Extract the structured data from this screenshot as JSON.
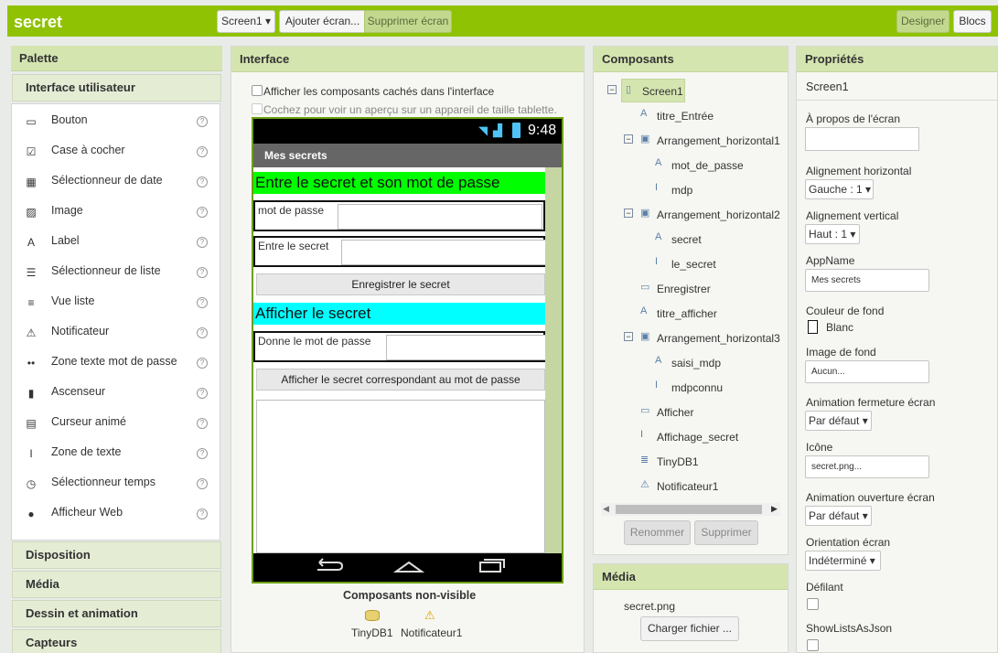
{
  "app": {
    "name": "secret"
  },
  "topbar": {
    "screen_select": "Screen1 ▾",
    "add_screen": "Ajouter écran...",
    "remove_screen": "Supprimer écran",
    "designer": "Designer",
    "blocks": "Blocs"
  },
  "palette": {
    "title": "Palette",
    "category_active": "Interface utilisateur",
    "items": [
      {
        "label": "Bouton",
        "icon": "button-icon"
      },
      {
        "label": "Case à cocher",
        "icon": "checkbox-icon"
      },
      {
        "label": "Sélectionneur de date",
        "icon": "date-picker-icon"
      },
      {
        "label": "Image",
        "icon": "image-icon"
      },
      {
        "label": "Label",
        "icon": "label-icon"
      },
      {
        "label": "Sélectionneur de liste",
        "icon": "list-picker-icon"
      },
      {
        "label": "Vue liste",
        "icon": "list-view-icon"
      },
      {
        "label": "Notificateur",
        "icon": "notifier-icon"
      },
      {
        "label": "Zone texte mot de passe",
        "icon": "password-icon"
      },
      {
        "label": "Ascenseur",
        "icon": "slider-icon"
      },
      {
        "label": "Curseur animé",
        "icon": "spinner-icon"
      },
      {
        "label": "Zone de texte",
        "icon": "textbox-icon"
      },
      {
        "label": "Sélectionneur temps",
        "icon": "time-picker-icon"
      },
      {
        "label": "Afficheur Web",
        "icon": "web-viewer-icon"
      }
    ],
    "help": "?",
    "categories": [
      "Disposition",
      "Média",
      "Dessin et animation",
      "Capteurs"
    ]
  },
  "viewer": {
    "title": "Interface",
    "show_hidden": "Afficher les composants cachés dans l'interface",
    "tablet_preview": "Cochez pour voir un aperçu sur un appareil de taille tablette.",
    "time": "9:48",
    "screen_title": "Mes secrets",
    "label1": "Entre le secret et son mot de passe",
    "row1_label": "mot de passe",
    "row2_label": "Entre le secret",
    "save_button": "Enregistrer le secret",
    "label2": "Afficher le secret",
    "row3_label": "Donne le mot de passe",
    "show_button": "Afficher le secret correspondant au mot de passe",
    "nonvisible_title": "Composants non-visible",
    "nonvisible": [
      "TinyDB1",
      "Notificateur1"
    ]
  },
  "components": {
    "title": "Composants",
    "tree": [
      {
        "label": "Screen1",
        "level": 0,
        "toggle": "−",
        "icon": "screen-icon",
        "selected": true
      },
      {
        "label": "titre_Entrée",
        "level": 1,
        "icon": "label-icon"
      },
      {
        "label": "Arrangement_horizontal1",
        "level": 1,
        "toggle": "−",
        "icon": "arrangement-icon"
      },
      {
        "label": "mot_de_passe",
        "level": 2,
        "icon": "label-icon"
      },
      {
        "label": "mdp",
        "level": 2,
        "icon": "textbox-icon"
      },
      {
        "label": "Arrangement_horizontal2",
        "level": 1,
        "toggle": "−",
        "icon": "arrangement-icon"
      },
      {
        "label": "secret",
        "level": 2,
        "icon": "label-icon"
      },
      {
        "label": "le_secret",
        "level": 2,
        "icon": "textbox-icon"
      },
      {
        "label": "Enregistrer",
        "level": 1,
        "icon": "button-icon"
      },
      {
        "label": "titre_afficher",
        "level": 1,
        "icon": "label-icon"
      },
      {
        "label": "Arrangement_horizontal3",
        "level": 1,
        "toggle": "−",
        "icon": "arrangement-icon"
      },
      {
        "label": "saisi_mdp",
        "level": 2,
        "icon": "label-icon"
      },
      {
        "label": "mdpconnu",
        "level": 2,
        "icon": "textbox-icon"
      },
      {
        "label": "Afficher",
        "level": 1,
        "icon": "button-icon"
      },
      {
        "label": "Affichage_secret",
        "level": 1,
        "icon": "textbox-icon"
      },
      {
        "label": "TinyDB1",
        "level": 1,
        "icon": "database-icon"
      },
      {
        "label": "Notificateur1",
        "level": 1,
        "icon": "notifier-icon"
      }
    ],
    "rename": "Renommer",
    "delete": "Supprimer"
  },
  "media": {
    "title": "Média",
    "file": "secret.png",
    "upload": "Charger fichier ..."
  },
  "properties": {
    "title": "Propriétés",
    "component": "Screen1",
    "about_label": "À propos de l'écran",
    "align_h_label": "Alignement horizontal",
    "align_h": "Gauche : 1 ▾",
    "align_v_label": "Alignement vertical",
    "align_v": "Haut : 1 ▾",
    "appname_label": "AppName",
    "appname": "Mes secrets",
    "bgcolor_label": "Couleur de fond",
    "bgcolor": "Blanc",
    "bgimage_label": "Image de fond",
    "bgimage": "Aucun...",
    "close_anim_label": "Animation fermeture écran",
    "close_anim": "Par défaut ▾",
    "icon_label": "Icône",
    "icon": "secret.png...",
    "open_anim_label": "Animation ouverture écran",
    "open_anim": "Par défaut ▾",
    "orientation_label": "Orientation écran",
    "orientation": "Indéterminé ▾",
    "scrollable_label": "Défilant",
    "showlists_label": "ShowListsAsJson"
  },
  "colors": {
    "brand_green": "#8fc202",
    "label_green": "#00ff00",
    "label_cyan": "#00ffff"
  }
}
